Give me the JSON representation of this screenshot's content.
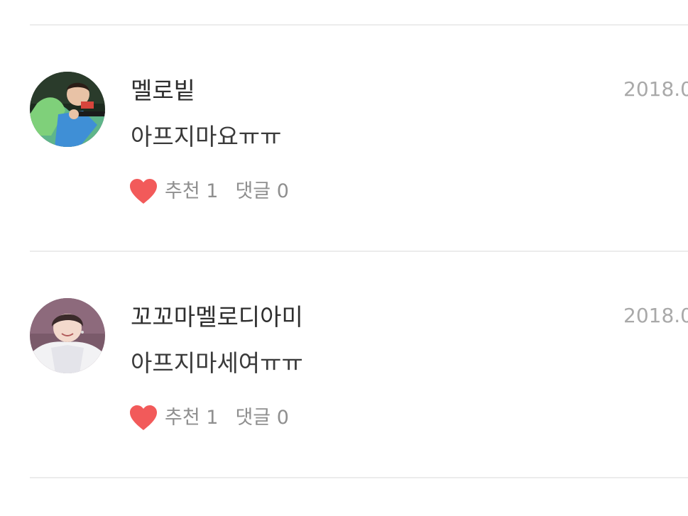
{
  "comments": [
    {
      "author": "멜로빝",
      "date": "2018.0",
      "text": "아프지마요ㅠㅠ",
      "like_label": "추천 1",
      "reply_label": "댓글 0",
      "avatar_icon": "profile-photo-green-shirt-microphone"
    },
    {
      "author": "꼬꼬마멜로디아미",
      "date": "2018.0",
      "text": "아프지마세여ㅠㅠ",
      "like_label": "추천 1",
      "reply_label": "댓글 0",
      "avatar_icon": "profile-photo-white-hoodie"
    }
  ],
  "colors": {
    "heart": "#f25a5a",
    "divider": "#ececec",
    "meta_text": "#8f8f8f",
    "date_text": "#a9a9a9"
  }
}
